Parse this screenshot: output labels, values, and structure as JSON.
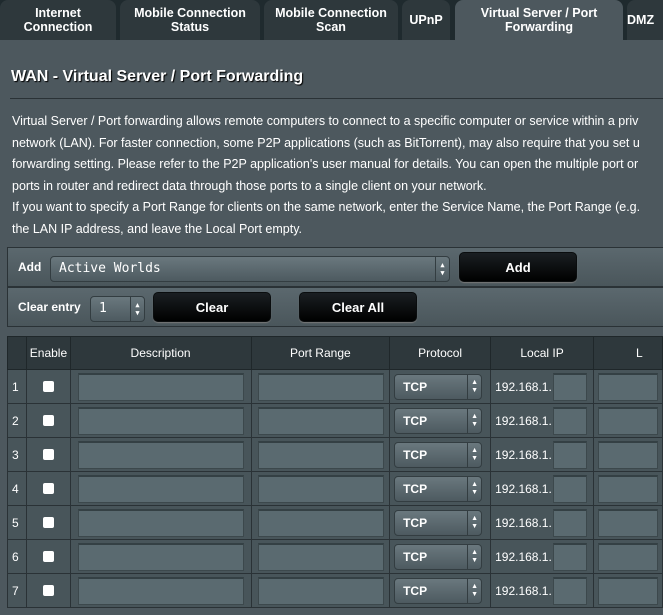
{
  "tabs": [
    {
      "label": "Internet Connection",
      "active": false
    },
    {
      "label": "Mobile Connection Status",
      "active": false
    },
    {
      "label": "Mobile Connection Scan",
      "active": false
    },
    {
      "label": "UPnP",
      "active": false
    },
    {
      "label": "Virtual Server / Port Forwarding",
      "active": true
    },
    {
      "label": "DMZ",
      "active": false
    }
  ],
  "page_title": "WAN - Virtual Server / Port Forwarding",
  "description_lines": [
    "Virtual Server / Port forwarding allows remote computers to connect to a specific computer or service within a priv",
    "network (LAN). For faster connection, some P2P applications (such as BitTorrent), may also require that you set u",
    "forwarding setting. Please refer to the P2P application's user manual for details. You can open the multiple port or",
    "ports in router and redirect data through those ports to a single client on your network.",
    "If you want to specify a Port Range for clients on the same network, enter the Service Name, the Port Range (e.g.",
    "the LAN IP address, and leave the Local Port empty."
  ],
  "add_bar": {
    "label": "Add",
    "selected_service": "Active Worlds",
    "add_button": "Add"
  },
  "clear_bar": {
    "label": "Clear entry",
    "selected_entry": "1",
    "clear_button": "Clear",
    "clear_all_button": "Clear All"
  },
  "table": {
    "headers": [
      "",
      "Enable",
      "Description",
      "Port Range",
      "Protocol",
      "Local IP",
      "L"
    ],
    "rows": [
      {
        "num": "1",
        "protocol": "TCP",
        "ip_prefix": "192.168.1."
      },
      {
        "num": "2",
        "protocol": "TCP",
        "ip_prefix": "192.168.1."
      },
      {
        "num": "3",
        "protocol": "TCP",
        "ip_prefix": "192.168.1."
      },
      {
        "num": "4",
        "protocol": "TCP",
        "ip_prefix": "192.168.1."
      },
      {
        "num": "5",
        "protocol": "TCP",
        "ip_prefix": "192.168.1."
      },
      {
        "num": "6",
        "protocol": "TCP",
        "ip_prefix": "192.168.1."
      },
      {
        "num": "7",
        "protocol": "TCP",
        "ip_prefix": "192.168.1."
      }
    ]
  }
}
